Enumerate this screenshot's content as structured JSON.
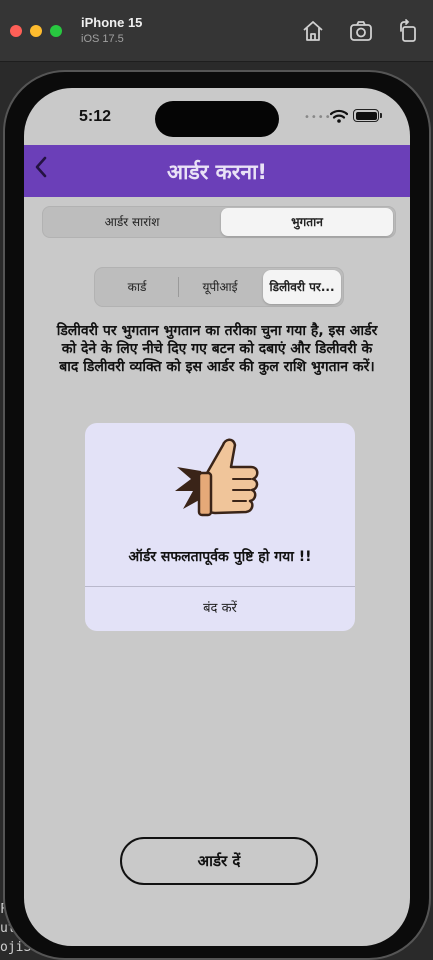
{
  "simulator": {
    "device_name": "iPhone 15",
    "os_version": "iOS 17.5",
    "icons": [
      "home-icon",
      "screenshot-icon",
      "rotate-icon"
    ]
  },
  "background_code": [
    "Fo",
    "uth",
    "ojiSea"
  ],
  "status_bar": {
    "time": "5:12",
    "dots": "••••"
  },
  "navbar": {
    "back_icon": "chevron-left-icon",
    "title": "आर्डर करना!"
  },
  "main_tabs": [
    {
      "label": "आर्डर सारांश",
      "selected": false
    },
    {
      "label": "भुगतान",
      "selected": true
    }
  ],
  "payment_tabs": [
    {
      "label": "कार्ड",
      "selected": false
    },
    {
      "label": "यूपीआई",
      "selected": false
    },
    {
      "label": "डिलीवरी पर...",
      "selected": true
    }
  ],
  "info_text": "डिलीवरी पर भुगतान भुगतान का तरीका चुना गया है, इस आर्डर को देने के लिए नीचे दिए गए बटन को दबाएं और डिलीवरी के बाद डिलीवरी व्यक्ति को इस आर्डर की कुल राशि भुगतान करें।",
  "alert": {
    "icon": "thumbs-up-icon",
    "message": "ऑर्डर सफलतापूर्वक पुष्टि हो गया !!",
    "close_label": "बंद करें"
  },
  "order_button": {
    "label": "आर्डर दें"
  },
  "colors": {
    "navbar": "#6b3fb8",
    "screen_background": "#c9c9c9",
    "alert_background": "#e3e2f7"
  }
}
